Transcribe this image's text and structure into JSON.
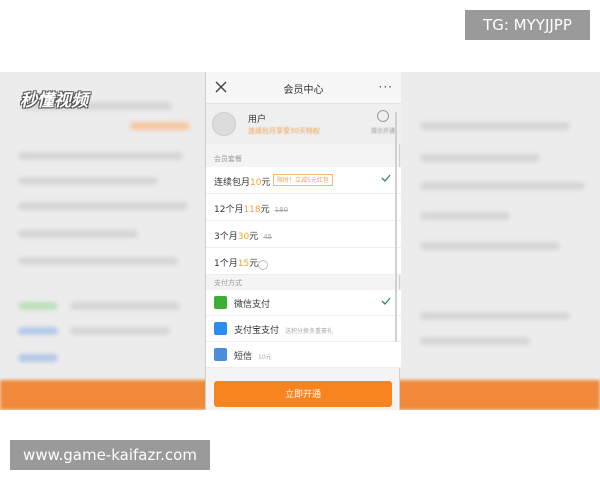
{
  "watermarks": {
    "tg": "TG: MYYJJPP",
    "site": "www.game-kaifazr.com",
    "video_logo": "秒懂视频"
  },
  "header": {
    "title": "会员中心",
    "close_icon": "close-icon",
    "more": "···"
  },
  "profile": {
    "username": "用户",
    "promo": "连续包月享受30天特权",
    "renew": "提示开通"
  },
  "plans": {
    "section_label": "会员套餐",
    "items": [
      {
        "pre": "连续包月",
        "price": "10",
        "post": "元",
        "old": "",
        "tag": "限时！立减5元红包",
        "selected": true
      },
      {
        "pre": "12个月",
        "price": "118",
        "post": "元",
        "old": "180",
        "tag": "",
        "selected": false
      },
      {
        "pre": "3个月",
        "price": "30",
        "post": "元",
        "old": "45",
        "tag": "",
        "selected": false
      },
      {
        "pre": "1个月",
        "price": "15",
        "post": "元",
        "old": "",
        "tag": "",
        "selected": false
      }
    ]
  },
  "payment": {
    "section_label": "支付方式",
    "items": [
      {
        "label": "微信支付",
        "note": "",
        "icon": "wechat-icon",
        "color": "#3cb034",
        "selected": true
      },
      {
        "label": "支付宝支付",
        "note": "送积分换多重豪礼",
        "icon": "alipay-icon",
        "color": "#2d8cf0",
        "selected": false
      },
      {
        "label": "短信",
        "note": "10元",
        "icon": "sms-icon",
        "color": "#4a90d9",
        "selected": false
      }
    ]
  },
  "footer": {
    "open_button": "立即开通"
  },
  "colors": {
    "accent": "#f7841f",
    "price": "#f5a623",
    "check": "#2e8b6e"
  }
}
